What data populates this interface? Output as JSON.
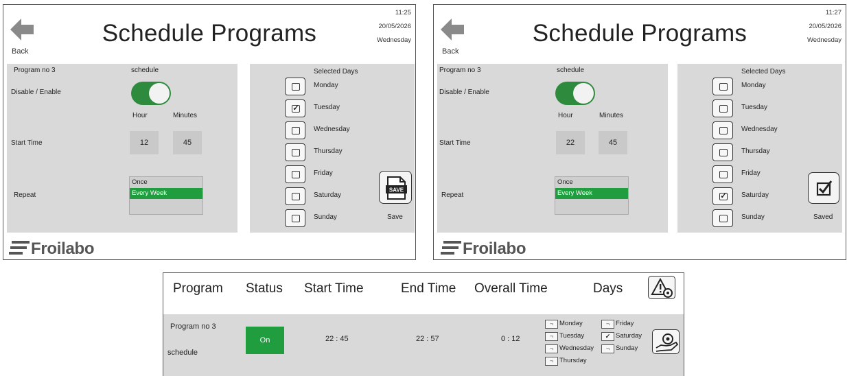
{
  "screen1": {
    "back_label": "Back",
    "title": "Schedule Programs",
    "time": "11:25",
    "date": "20/05/2026",
    "weekday": "Wednesday",
    "program_label": "Program no 3",
    "program_name": "schedule",
    "enable_label": "Disable / Enable",
    "enabled": true,
    "hour_label": "Hour",
    "minutes_label": "Minutes",
    "start_time_label": "Start Time",
    "start_hour": "12",
    "start_minutes": "45",
    "repeat_label": "Repeat",
    "repeat_options": [
      "Once",
      "Every Week",
      ""
    ],
    "repeat_selected": "Every Week",
    "selected_days_label": "Selected Days",
    "days": [
      {
        "name": "Monday",
        "checked": false
      },
      {
        "name": "Tuesday",
        "checked": true
      },
      {
        "name": "Wednesday",
        "checked": false
      },
      {
        "name": "Thursday",
        "checked": false
      },
      {
        "name": "Friday",
        "checked": false
      },
      {
        "name": "Saturday",
        "checked": false
      },
      {
        "name": "Sunday",
        "checked": false
      }
    ],
    "save_icon_text": "SAVE",
    "save_label": "Save",
    "logo_text": "Froilabo"
  },
  "screen2": {
    "back_label": "Back",
    "title": "Schedule Programs",
    "time": "11:27",
    "date": "20/05/2026",
    "weekday": "Wednesday",
    "program_label": "Program no 3",
    "program_name": "schedule",
    "enable_label": "Disable / Enable",
    "enabled": true,
    "hour_label": "Hour",
    "minutes_label": "Minutes",
    "start_time_label": "Start Time",
    "start_hour": "22",
    "start_minutes": "45",
    "repeat_label": "Repeat",
    "repeat_options": [
      "Once",
      "Every Week",
      ""
    ],
    "repeat_selected": "Every Week",
    "selected_days_label": "Selected Days",
    "days": [
      {
        "name": "Monday",
        "checked": false
      },
      {
        "name": "Tuesday",
        "checked": false
      },
      {
        "name": "Wednesday",
        "checked": false
      },
      {
        "name": "Thursday",
        "checked": false
      },
      {
        "name": "Friday",
        "checked": false
      },
      {
        "name": "Saturday",
        "checked": true
      },
      {
        "name": "Sunday",
        "checked": false
      }
    ],
    "save_label": "Saved",
    "logo_text": "Froilabo"
  },
  "status": {
    "headers": {
      "program": "Program",
      "status": "Status",
      "start_time": "Start Time",
      "end_time": "End Time",
      "overall_time": "Overall Time",
      "days": "Days"
    },
    "row": {
      "program_label": "Program no 3",
      "program_name": "schedule",
      "status": "On",
      "start_time": "22 : 45",
      "end_time": "22 : 57",
      "overall_time": "0 : 12"
    },
    "days": [
      {
        "name": "Monday",
        "checked": false
      },
      {
        "name": "Tuesday",
        "checked": false
      },
      {
        "name": "Wednesday",
        "checked": false
      },
      {
        "name": "Thursday",
        "checked": false
      },
      {
        "name": "Friday",
        "checked": false
      },
      {
        "name": "Saturday",
        "checked": true
      },
      {
        "name": "Sunday",
        "checked": false
      }
    ]
  },
  "colors": {
    "accent_green": "#1f9d3f",
    "toggle_green": "#2e8b3e",
    "panel_grey": "#d9d9d9"
  }
}
